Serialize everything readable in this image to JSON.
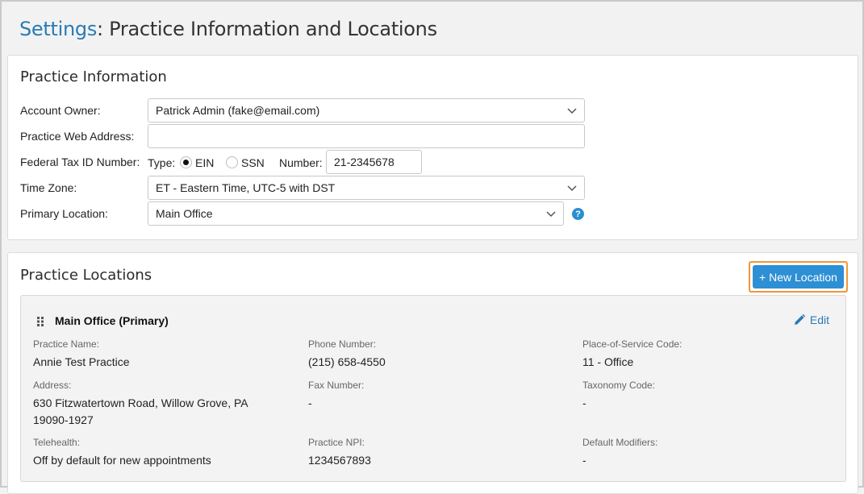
{
  "page": {
    "crumb": "Settings",
    "title": ": Practice Information and Locations"
  },
  "practice_info": {
    "heading": "Practice Information",
    "account_owner": {
      "label": "Account Owner:",
      "value": "Patrick Admin (fake@email.com)"
    },
    "web_address": {
      "label": "Practice Web Address:",
      "value": ""
    },
    "tax_id": {
      "label": "Federal Tax ID Number:",
      "type_label": "Type:",
      "options": [
        "EIN",
        "SSN"
      ],
      "selected": "EIN",
      "number_label": "Number:",
      "number_value": "21-2345678"
    },
    "time_zone": {
      "label": "Time Zone:",
      "value": "ET - Eastern Time, UTC-5 with DST"
    },
    "primary_location": {
      "label": "Primary Location:",
      "value": "Main Office"
    }
  },
  "practice_locations": {
    "heading": "Practice Locations",
    "new_button": "+ New Location",
    "location": {
      "title": "Main Office (Primary)",
      "edit_label": "Edit",
      "fields": {
        "practice_name": {
          "label": "Practice Name:",
          "value": "Annie Test Practice"
        },
        "phone": {
          "label": "Phone Number:",
          "value": "(215) 658-4550"
        },
        "pos_code": {
          "label": "Place-of-Service Code:",
          "value": "11 - Office"
        },
        "address": {
          "label": "Address:",
          "line1": "630 Fitzwatertown Road, Willow Grove, PA",
          "line2": "19090-1927"
        },
        "fax": {
          "label": "Fax Number:",
          "value": "-"
        },
        "taxonomy": {
          "label": "Taxonomy Code:",
          "value": "-"
        },
        "telehealth": {
          "label": "Telehealth:",
          "value": "Off by default for new appointments"
        },
        "npi": {
          "label": "Practice NPI:",
          "value": "1234567893"
        },
        "modifiers": {
          "label": "Default Modifiers:",
          "value": "-"
        }
      }
    }
  },
  "colors": {
    "accent": "#2a7bb5",
    "button": "#2d8fd4",
    "highlight": "#f0963a"
  }
}
